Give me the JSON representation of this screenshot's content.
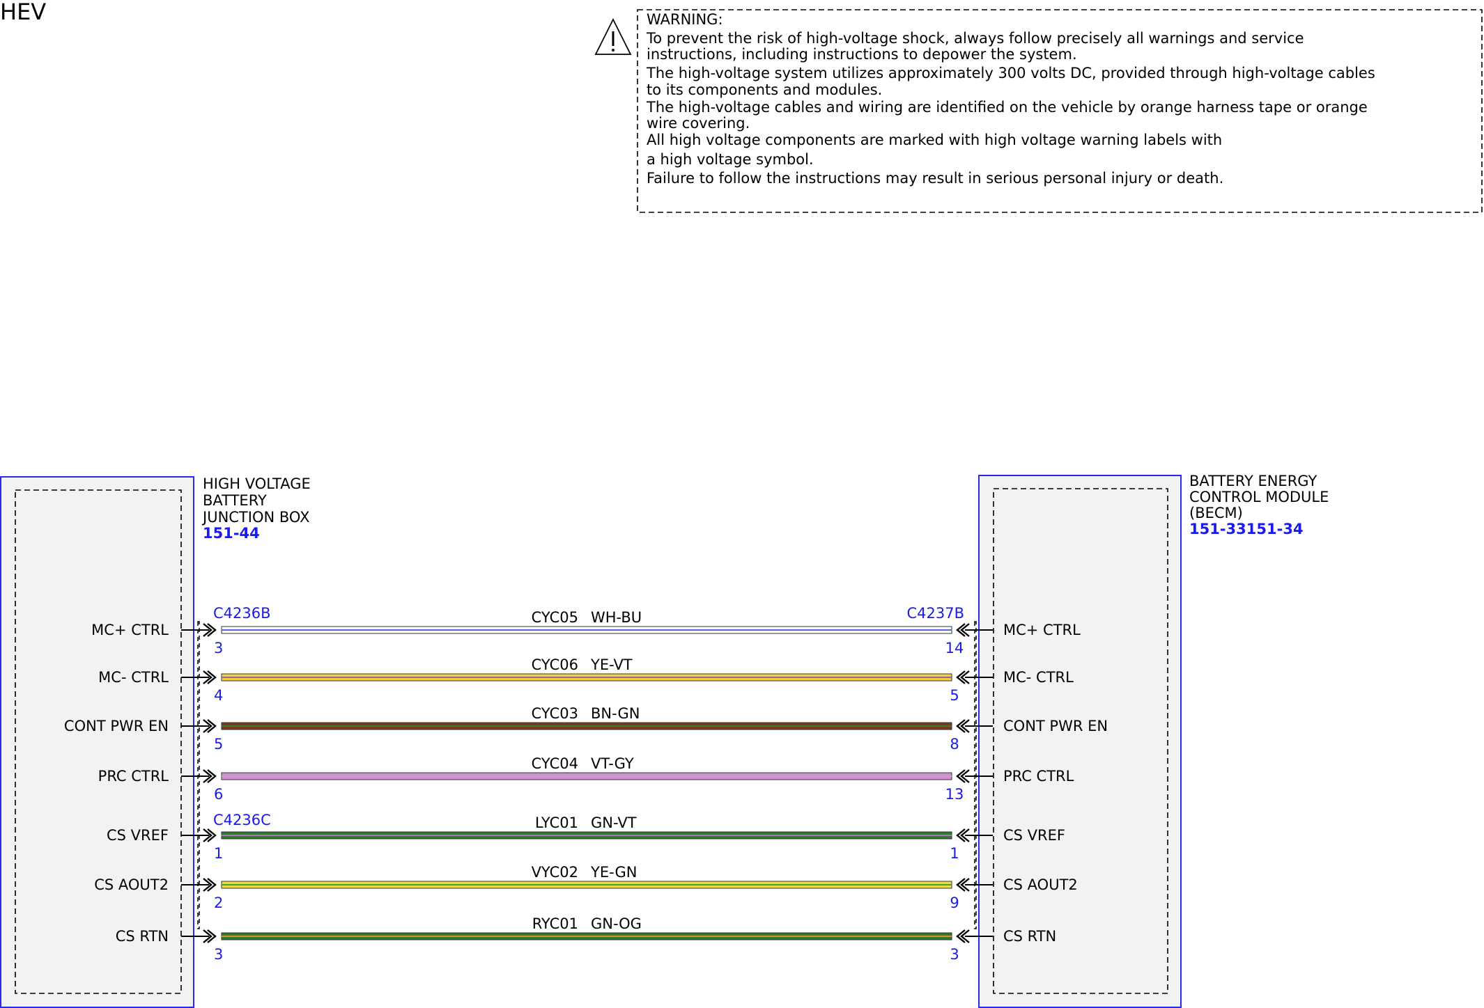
{
  "page": {
    "title": "HEV"
  },
  "warning": {
    "icon": "warning-triangle-icon",
    "lines": [
      "WARNING:",
      "To prevent the risk of high-voltage shock, always follow precisely all warnings and service",
      "instructions, including instructions to depower the system.",
      "The high-voltage system utilizes approximately 300 volts DC, provided through high-voltage cables",
      "to its components and modules.",
      "The high-voltage cables and wiring are identified on the vehicle by orange harness tape or orange",
      "wire covering.",
      "All high voltage components are marked with high voltage warning labels with",
      "a high voltage symbol.",
      "Failure to follow the instructions may result in serious personal injury or death."
    ]
  },
  "left_component": {
    "name_lines": [
      "HIGH VOLTAGE",
      "BATTERY",
      "JUNCTION BOX"
    ],
    "ref": "151-44"
  },
  "right_component": {
    "name_lines": [
      "BATTERY ENERGY",
      "CONTROL MODULE",
      "(BECM)"
    ],
    "ref": "151-33151-34"
  },
  "connectors": {
    "left_top": "C4236B",
    "left_bottom": "C4236C",
    "right_top": "C4237B"
  },
  "circuits": [
    {
      "left_label": "MC+ CTRL",
      "left_pin": "3",
      "circuit": "CYC05",
      "color_code": "WH-BU",
      "right_pin": "14",
      "right_label": "MC+ CTRL",
      "base": "#ffffff",
      "stripe": "#4a6ad8"
    },
    {
      "left_label": "MC- CTRL",
      "left_pin": "4",
      "circuit": "CYC06",
      "color_code": "YE-VT",
      "right_pin": "5",
      "right_label": "MC- CTRL",
      "base": "#f0d040",
      "stripe": "#a060a0"
    },
    {
      "left_label": "CONT PWR EN",
      "left_pin": "5",
      "circuit": "CYC03",
      "color_code": "BN-GN",
      "right_pin": "8",
      "right_label": "CONT PWR EN",
      "base": "#7a3a22",
      "stripe": "#3a7a2a"
    },
    {
      "left_label": "PRC CTRL",
      "left_pin": "6",
      "circuit": "CYC04",
      "color_code": "VT-GY",
      "right_pin": "13",
      "right_label": "PRC CTRL",
      "base": "#d88ad8",
      "stripe": "#b0b0b0"
    },
    {
      "left_label": "CS VREF",
      "left_pin": "1",
      "circuit": "LYC01",
      "color_code": "GN-VT",
      "right_pin": "1",
      "right_label": "CS VREF",
      "base": "#2e7a2e",
      "stripe": "#b070c0"
    },
    {
      "left_label": "CS AOUT2",
      "left_pin": "2",
      "circuit": "VYC02",
      "color_code": "YE-GN",
      "right_pin": "9",
      "right_label": "CS AOUT2",
      "base": "#e8e040",
      "stripe": "#4a9a30"
    },
    {
      "left_label": "CS RTN",
      "left_pin": "3",
      "circuit": "RYC01",
      "color_code": "GN-OG",
      "right_pin": "3",
      "right_label": "CS RTN",
      "base": "#2e7a2e",
      "stripe": "#e09030"
    }
  ]
}
